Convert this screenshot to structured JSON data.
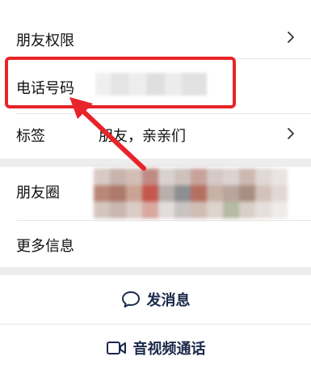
{
  "profile_settings": {
    "friend_permissions": {
      "label": "朋友权限",
      "icon": "chevron-right-icon"
    },
    "phone_number": {
      "label": "电话号码",
      "value_state": "blurred"
    },
    "tags": {
      "label": "标签",
      "value": "朋友，亲亲们",
      "icon": "chevron-right-icon"
    }
  },
  "profile_info": {
    "moments": {
      "label": "朋友圈",
      "preview_state": "blurred"
    },
    "more_info": {
      "label": "更多信息"
    }
  },
  "actions": {
    "send_message": {
      "label": "发消息",
      "icon": "chat-bubble-icon"
    },
    "video_call": {
      "label": "音视频通话",
      "icon": "video-camera-icon"
    }
  },
  "annotation": {
    "highlight_color": "#e8232a",
    "target": "phone_number"
  },
  "colors": {
    "background": "#ededed",
    "card": "#ffffff",
    "text": "#111111",
    "action_text": "#1b2a4a",
    "chevron": "#333333"
  }
}
